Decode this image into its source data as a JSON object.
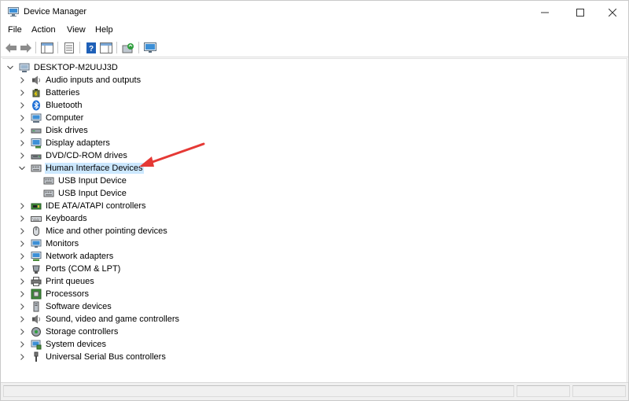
{
  "window": {
    "title": "Device Manager"
  },
  "menu": {
    "file": "File",
    "action": "Action",
    "view": "View",
    "help": "Help"
  },
  "tree": {
    "root": "DESKTOP-M2UUJ3D",
    "categories": [
      {
        "label": "Audio inputs and outputs",
        "icon": "speaker-icon",
        "expanded": false
      },
      {
        "label": "Batteries",
        "icon": "battery-icon",
        "expanded": false
      },
      {
        "label": "Bluetooth",
        "icon": "bluetooth-icon",
        "expanded": false
      },
      {
        "label": "Computer",
        "icon": "computer-icon",
        "expanded": false
      },
      {
        "label": "Disk drives",
        "icon": "disk-drive-icon",
        "expanded": false
      },
      {
        "label": "Display adapters",
        "icon": "display-adapter-icon",
        "expanded": false
      },
      {
        "label": "DVD/CD-ROM drives",
        "icon": "dvd-drive-icon",
        "expanded": false
      },
      {
        "label": "Human Interface Devices",
        "icon": "hid-icon",
        "expanded": true,
        "selected": true,
        "children": [
          "USB Input Device",
          "USB Input Device"
        ]
      },
      {
        "label": "IDE ATA/ATAPI controllers",
        "icon": "ide-controller-icon",
        "expanded": false
      },
      {
        "label": "Keyboards",
        "icon": "keyboard-icon",
        "expanded": false
      },
      {
        "label": "Mice and other pointing devices",
        "icon": "mouse-icon",
        "expanded": false
      },
      {
        "label": "Monitors",
        "icon": "monitor-icon",
        "expanded": false
      },
      {
        "label": "Network adapters",
        "icon": "network-adapter-icon",
        "expanded": false
      },
      {
        "label": "Ports (COM & LPT)",
        "icon": "port-icon",
        "expanded": false
      },
      {
        "label": "Print queues",
        "icon": "printer-icon",
        "expanded": false
      },
      {
        "label": "Processors",
        "icon": "processor-icon",
        "expanded": false
      },
      {
        "label": "Software devices",
        "icon": "software-device-icon",
        "expanded": false
      },
      {
        "label": "Sound, video and game controllers",
        "icon": "sound-controller-icon",
        "expanded": false
      },
      {
        "label": "Storage controllers",
        "icon": "storage-controller-icon",
        "expanded": false
      },
      {
        "label": "System devices",
        "icon": "system-device-icon",
        "expanded": false
      },
      {
        "label": "Universal Serial Bus controllers",
        "icon": "usb-controller-icon",
        "expanded": false
      }
    ]
  },
  "colors": {
    "selection": "#cce8ff",
    "annotation_arrow": "#e53935"
  }
}
